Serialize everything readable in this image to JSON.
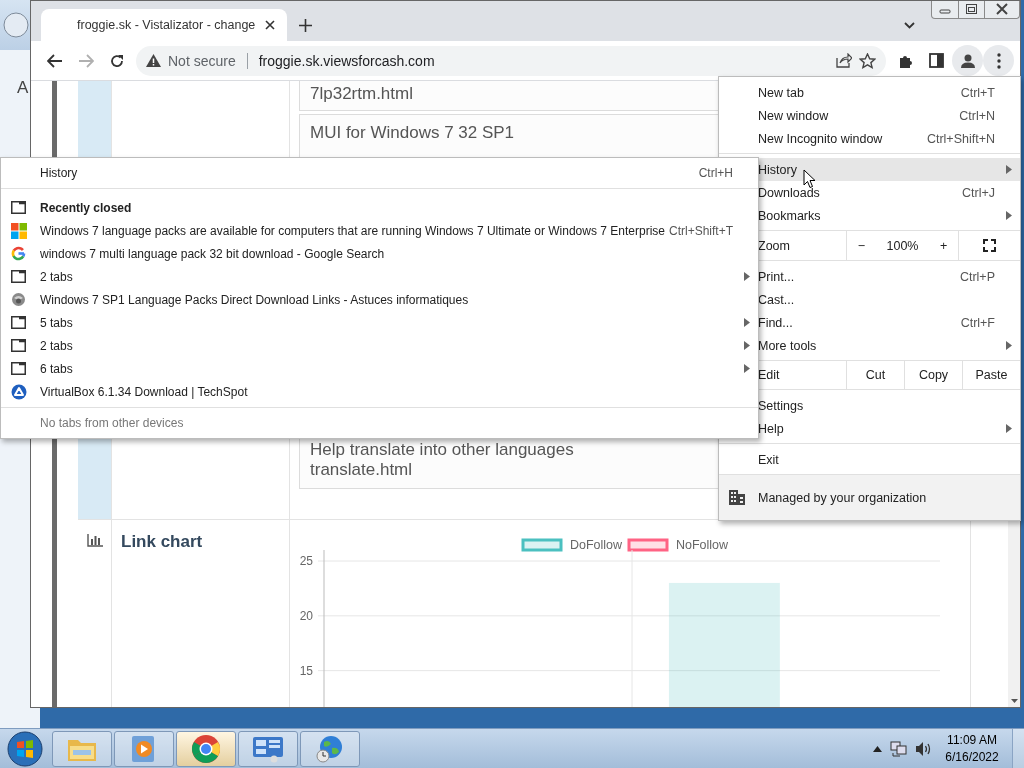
{
  "background_window": {
    "label": "A"
  },
  "browser": {
    "tab": {
      "title": "froggie.sk - Vistalizator - change",
      "selected": true
    },
    "security": "Not secure",
    "url": "froggie.sk.viewsforcash.com"
  },
  "page": {
    "entries": [
      {
        "lines": [
          "7lp32rtm.html"
        ]
      },
      {
        "lines": [
          "MUI for Windows 7 32 SP1"
        ]
      },
      {
        "lines": [
          "Help translate into other languages",
          "translate.html"
        ]
      }
    ],
    "link_chart": {
      "title": "Link chart",
      "chart_data": {
        "type": "bar",
        "series": [
          {
            "name": "DoFollow",
            "color": "#4bc0c0",
            "values": [
              null,
              23
            ]
          },
          {
            "name": "NoFollow",
            "color": "#ff6384",
            "values": [
              null,
              null
            ]
          }
        ],
        "ylim": [
          11.5,
          25
        ],
        "yticks": [
          15,
          20,
          25
        ]
      }
    }
  },
  "history_menu": {
    "header": {
      "label": "History",
      "shortcut": "Ctrl+H"
    },
    "items": [
      {
        "kind": "heading",
        "label": "Recently closed"
      },
      {
        "kind": "tiles",
        "label": "Windows 7 language packs are available for computers that are running Windows 7 Ultimate or Windows 7 Enterprise",
        "shortcut": "Ctrl+Shift+T"
      },
      {
        "kind": "g",
        "label": "windows 7 multi language pack 32 bit download - Google Search"
      },
      {
        "kind": "group",
        "label": "2 tabs"
      },
      {
        "kind": "ball",
        "label": "Windows 7 SP1 Language Packs Direct Download Links - Astuces informatiques"
      },
      {
        "kind": "group",
        "label": "5 tabs"
      },
      {
        "kind": "group",
        "label": "2 tabs"
      },
      {
        "kind": "group",
        "label": "6 tabs"
      },
      {
        "kind": "triangle",
        "label": "VirtualBox 6.1.34 Download | TechSpot"
      }
    ],
    "footer": "No tabs from other devices"
  },
  "main_menu": {
    "groups": [
      [
        {
          "kind": "item",
          "label": "New tab",
          "shortcut": "Ctrl+T",
          "submenu": false,
          "selected": false
        },
        {
          "kind": "item",
          "label": "New window",
          "shortcut": "Ctrl+N",
          "submenu": false,
          "selected": false
        },
        {
          "kind": "item",
          "label": "New Incognito window",
          "shortcut": "Ctrl+Shift+N",
          "submenu": false,
          "selected": false
        }
      ],
      [
        {
          "kind": "item",
          "label": "History",
          "submenu": true,
          "selected": true
        },
        {
          "kind": "item",
          "label": "Downloads",
          "shortcut": "Ctrl+J",
          "submenu": false,
          "selected": false
        },
        {
          "kind": "item",
          "label": "Bookmarks",
          "submenu": true,
          "selected": false
        }
      ],
      [
        {
          "kind": "zoom",
          "label": "Zoom",
          "minus": "−",
          "value": "100%",
          "plus": "+"
        }
      ],
      [
        {
          "kind": "item",
          "label": "Print...",
          "shortcut": "Ctrl+P",
          "submenu": false,
          "selected": false
        },
        {
          "kind": "item",
          "label": "Cast...",
          "submenu": false,
          "selected": false
        },
        {
          "kind": "item",
          "label": "Find...",
          "shortcut": "Ctrl+F",
          "submenu": false,
          "selected": false
        },
        {
          "kind": "item",
          "label": "More tools",
          "submenu": true,
          "selected": false
        }
      ],
      [
        {
          "kind": "edit",
          "label": "Edit",
          "actions": [
            "Cut",
            "Copy",
            "Paste"
          ]
        }
      ],
      [
        {
          "kind": "item",
          "label": "Settings",
          "submenu": false,
          "selected": false
        },
        {
          "kind": "item",
          "label": "Help",
          "submenu": true,
          "selected": false
        }
      ],
      [
        {
          "kind": "item",
          "label": "Exit",
          "submenu": false,
          "selected": false
        }
      ],
      [
        {
          "kind": "managed",
          "label": "Managed by your organization"
        }
      ]
    ]
  },
  "taskbar": {
    "apps": [
      {
        "kind": "folder",
        "selected": false
      },
      {
        "kind": "media",
        "selected": false
      },
      {
        "kind": "chrome",
        "selected": true
      },
      {
        "kind": "panel",
        "selected": false
      },
      {
        "kind": "globe",
        "selected": false
      }
    ],
    "time": "11:09 AM",
    "date": "6/16/2022"
  }
}
